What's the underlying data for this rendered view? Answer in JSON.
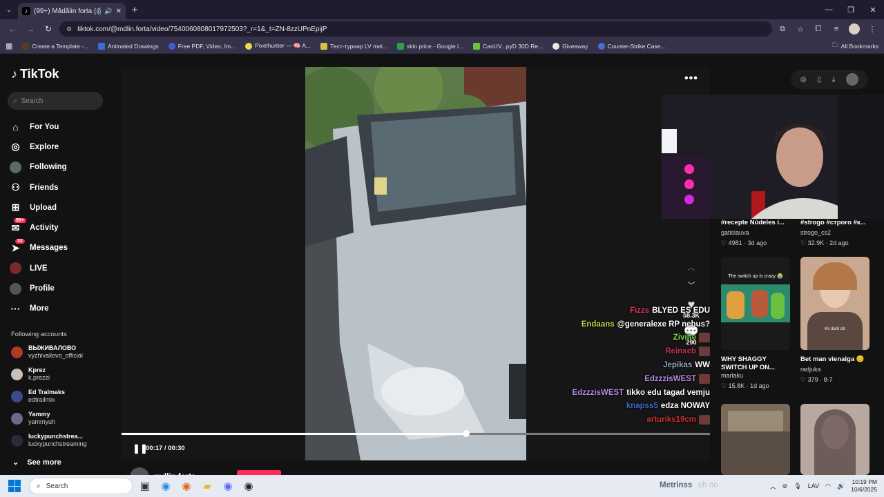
{
  "browser": {
    "tab_title": "(99+) Mădălin forta (@mdlin...",
    "url": "tiktok.com/@mdlin.forta/video/7540060808017972503?_r=1&_t=ZN-8zzUPnEpijP",
    "bookmarks": [
      "Create a Template -...",
      "Animated Drawings",
      "Free PDF, Video, Im...",
      "Pixelhunter — 🧠 A...",
      "Тест-турнир LV mei...",
      "skin price - Google i...",
      "CanUV...pyD 30D Re...",
      "Giveaway",
      "Counter-Strike Case..."
    ],
    "all_bookmarks": "All Bookmarks"
  },
  "tiktok": {
    "logo": "TikTok",
    "search_placeholder": "Search",
    "nav": {
      "for_you": "For You",
      "explore": "Explore",
      "following": "Following",
      "friends": "Friends",
      "upload": "Upload",
      "activity": "Activity",
      "activity_badge": "99+",
      "messages": "Messages",
      "messages_badge": "32",
      "live": "LIVE",
      "profile": "Profile",
      "more": "More"
    },
    "following_title": "Following accounts",
    "following_accounts": [
      {
        "name": "ВЫЖИВАЛОВО",
        "handle": "vyzhivallovo_official"
      },
      {
        "name": "Kprez",
        "handle": "k.prezzi"
      },
      {
        "name": "Ed Tralmaks",
        "handle": "edtrailmix"
      },
      {
        "name": "Yammy",
        "handle": "yammyuh"
      },
      {
        "name": "luckypunchstrea...",
        "handle": "luckypunchstreaming"
      }
    ],
    "see_more": "See more",
    "video": {
      "time": "00:17 / 00:30",
      "progress": 0.586,
      "likes": "58.3K",
      "comments": "290",
      "author": "mdlin.forta"
    },
    "recommended": [
      {
        "title": "#recepte Nūdeles i...",
        "author": "gatislauva",
        "stats": "4981 · 3d ago"
      },
      {
        "title": "#strogo #строго #к...",
        "author": "strogo_cs2",
        "stats": "32.9K · 2d ago"
      },
      {
        "title": "WHY SHAGGY SWITCH UP ON...",
        "author": "marlaku",
        "stats": "15.8K · 1d ago",
        "thumb_text": "The switch up is crazy 😭"
      },
      {
        "title": "Bet man vienalga 😊",
        "author": "radjuka",
        "stats": "379 · 8-7",
        "thumb_text": "Ko darit citi"
      }
    ]
  },
  "chat": [
    {
      "user": "Fizzs",
      "color": "#e03c5a",
      "msg": "BLYED ES EDU"
    },
    {
      "user": "Endaans",
      "color": "#c8d14a",
      "msg": "@generalexe RP nebus?"
    },
    {
      "user": "Zivilte",
      "color": "#7ee04a",
      "msg": ""
    },
    {
      "user": "Reinxeb",
      "color": "#c8325c",
      "msg": ""
    },
    {
      "user": "Jepikas",
      "color": "#9ca6c8",
      "msg": "WW"
    },
    {
      "user": "EdzzzisWEST",
      "color": "#b38ce0",
      "msg": ""
    },
    {
      "user": "EdzzzisWEST",
      "color": "#b38ce0",
      "msg": "tikko edu tagad vemju"
    },
    {
      "user": "knapss5",
      "color": "#3c6cd2",
      "msg": "edza NOWAY"
    },
    {
      "user": "arturiks19cm",
      "color": "#d03030",
      "msg": ""
    }
  ],
  "taskbar": {
    "search": "Search",
    "lang": "LAV",
    "time": "10:19 PM",
    "date": "10/6/2025",
    "overlay_user": "Metrinss",
    "overlay_msg": "oh no"
  }
}
